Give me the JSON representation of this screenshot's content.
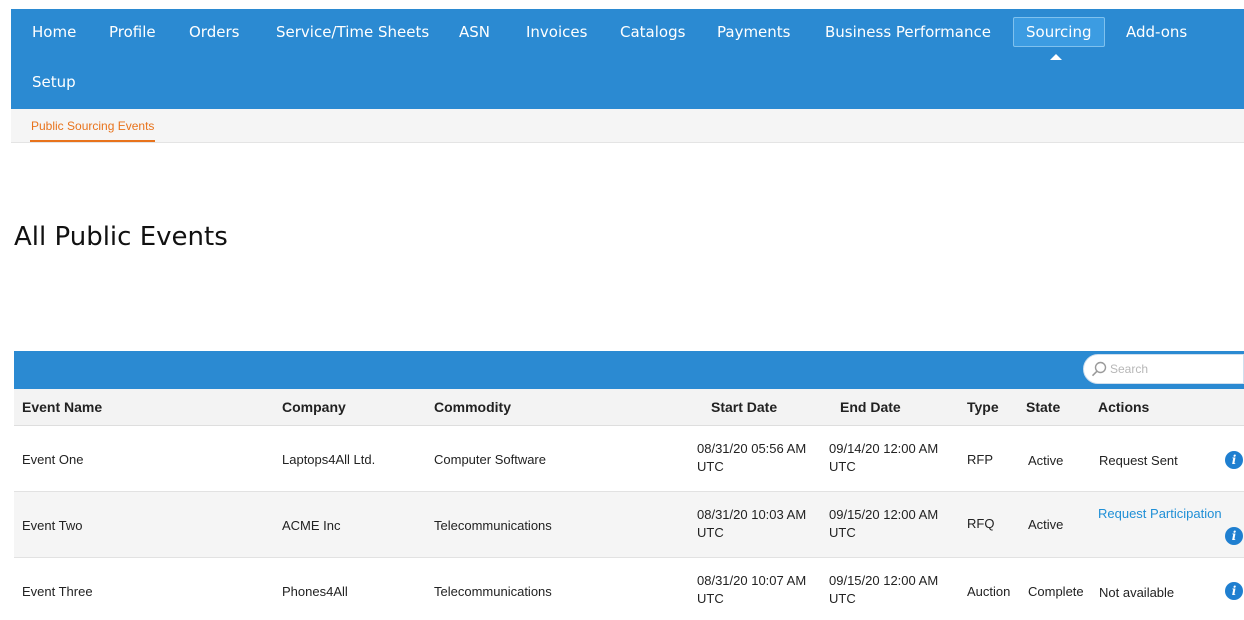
{
  "nav": {
    "items": [
      {
        "label": "Home"
      },
      {
        "label": "Profile"
      },
      {
        "label": "Orders"
      },
      {
        "label": "Service/Time Sheets"
      },
      {
        "label": "ASN"
      },
      {
        "label": "Invoices"
      },
      {
        "label": "Catalogs"
      },
      {
        "label": "Payments"
      },
      {
        "label": "Business Performance"
      },
      {
        "label": "Sourcing",
        "active": true
      },
      {
        "label": "Add-ons"
      },
      {
        "label": "Setup"
      }
    ]
  },
  "subnav": {
    "tab": "Public Sourcing Events"
  },
  "page": {
    "title": "All Public Events"
  },
  "search": {
    "placeholder": "Search",
    "icon": "search-icon"
  },
  "table": {
    "headers": [
      "Event Name",
      "Company",
      "Commodity",
      "Start Date",
      "End Date",
      "Type",
      "State",
      "Actions"
    ],
    "rows": [
      {
        "event_name": "Event One",
        "company": "Laptops4All Ltd.",
        "commodity": "Computer Software",
        "start_date": "08/31/20 05:56 AM UTC",
        "end_date": "09/14/20 12:00 AM UTC",
        "type": "RFP",
        "state": "Active",
        "action": "Request Sent",
        "info_icon": "i"
      },
      {
        "event_name": "Event Two",
        "company": "ACME Inc",
        "commodity": "Telecommunications",
        "start_date": "08/31/20 10:03 AM UTC",
        "end_date": "09/15/20 12:00 AM UTC",
        "type": "RFQ",
        "state": "Active",
        "action": "Request Participation",
        "info_icon": "i"
      },
      {
        "event_name": "Event Three",
        "company": "Phones4All",
        "commodity": "Telecommunications",
        "start_date": "08/31/20 10:07 AM UTC",
        "end_date": "09/15/20 12:00 AM UTC",
        "type": "Auction",
        "state": "Complete",
        "action": "Not available",
        "info_icon": "i"
      }
    ]
  },
  "colors": {
    "nav_bg": "#2b8ad2",
    "accent": "#e8731c",
    "link": "#1f8fd6",
    "info": "#1f7fd0"
  }
}
